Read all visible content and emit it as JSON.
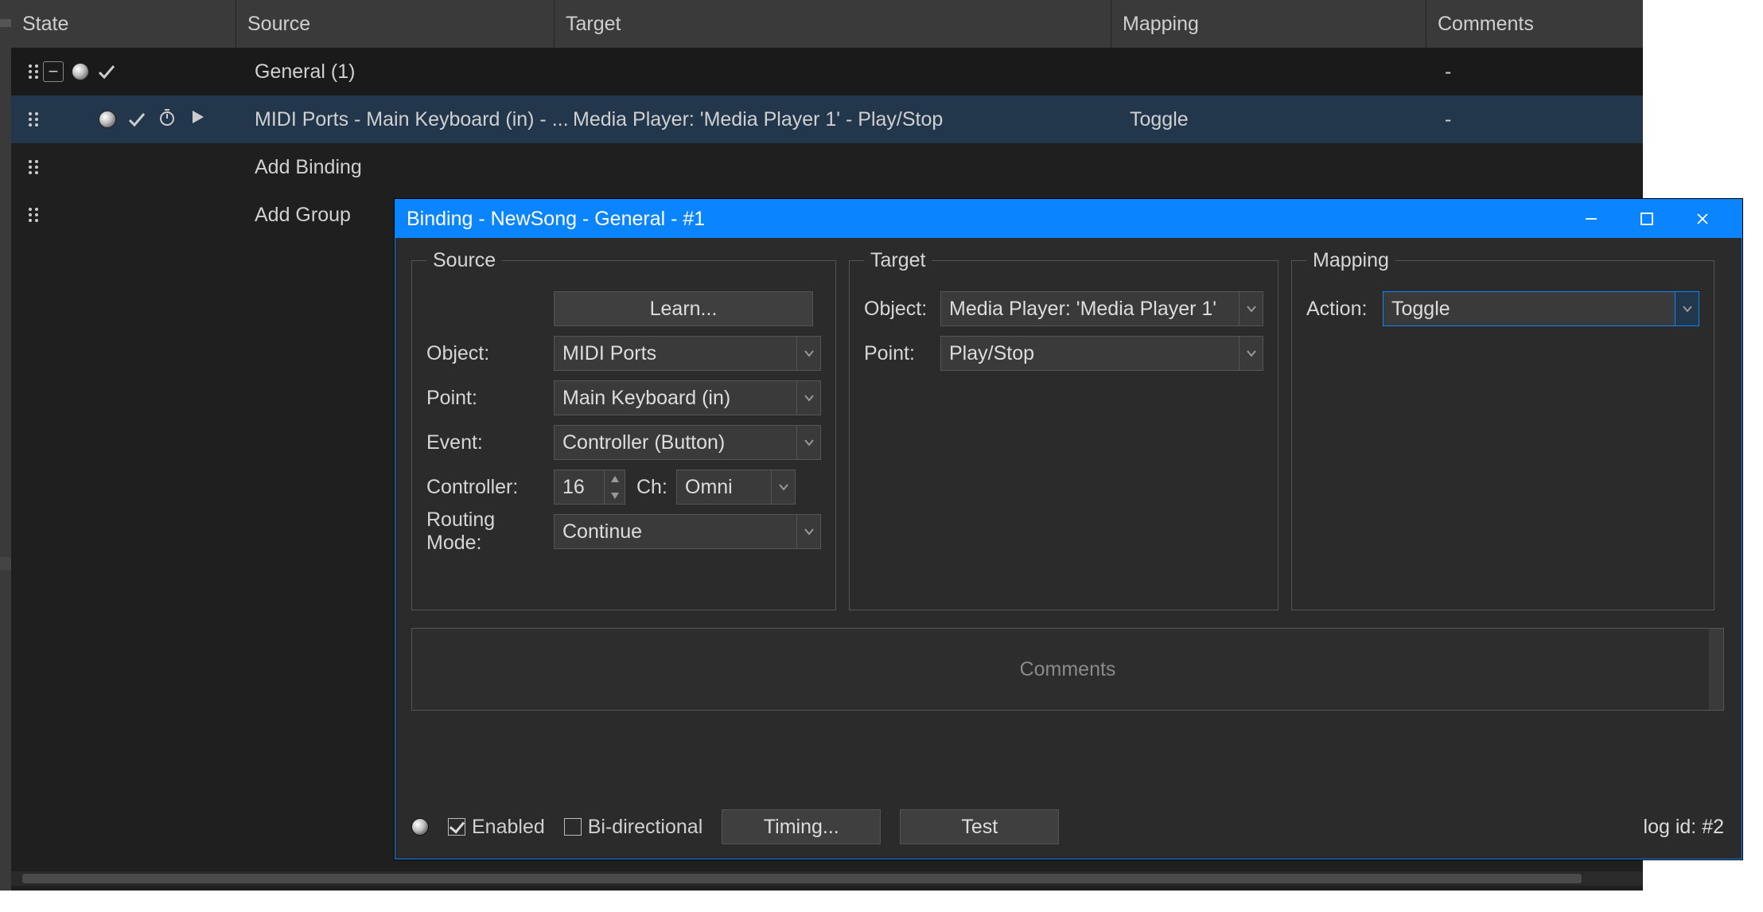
{
  "columns": {
    "state": "State",
    "source": "Source",
    "target": "Target",
    "mapping": "Mapping",
    "comments": "Comments"
  },
  "rows": {
    "group": {
      "label": "General (1)",
      "comments": "-"
    },
    "binding": {
      "source": "MIDI Ports - Main Keyboard (in) - ...",
      "target": "Media Player: 'Media Player 1' - Play/Stop",
      "mapping": "Toggle",
      "comments": "-"
    },
    "addBinding": "Add Binding",
    "addGroup": "Add Group"
  },
  "dialog": {
    "title": "Binding - NewSong - General - #1",
    "source": {
      "legend": "Source",
      "learn": "Learn...",
      "object_label": "Object:",
      "object": "MIDI Ports",
      "point_label": "Point:",
      "point": "Main Keyboard (in)",
      "event_label": "Event:",
      "event": "Controller (Button)",
      "controller_label": "Controller:",
      "controller": "16",
      "ch_label": "Ch:",
      "ch": "Omni",
      "routing_label": "Routing Mode:",
      "routing": "Continue"
    },
    "target": {
      "legend": "Target",
      "object_label": "Object:",
      "object": "Media Player: 'Media Player 1'",
      "point_label": "Point:",
      "point": "Play/Stop"
    },
    "mapping": {
      "legend": "Mapping",
      "action_label": "Action:",
      "action": "Toggle"
    },
    "comments_placeholder": "Comments",
    "footer": {
      "enabled": "Enabled",
      "bidirectional": "Bi-directional",
      "timing": "Timing...",
      "test": "Test",
      "logid": "log id: #2"
    }
  }
}
